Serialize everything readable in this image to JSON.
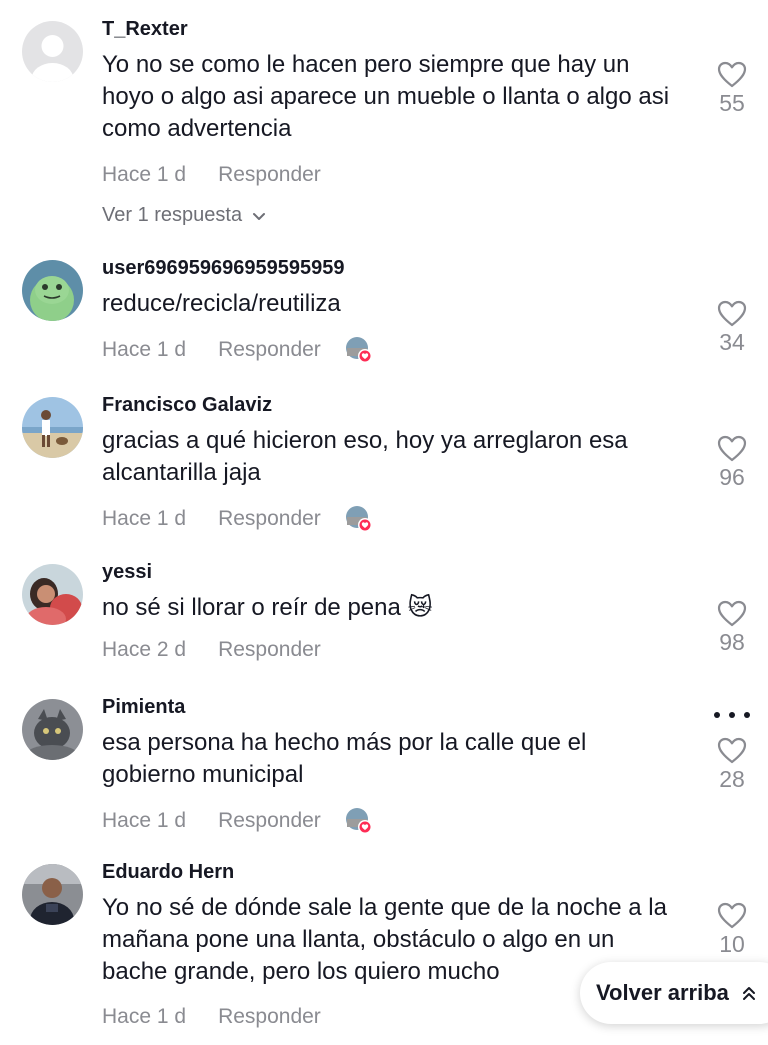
{
  "comments": [
    {
      "username": "T_Rexter",
      "text": "Yo no se como le hacen pero siempre que hay un hoyo o algo asi aparece un mueble o llanta o algo asi como advertencia",
      "time": "Hace 1 d",
      "reply_label": "Responder",
      "likes": "55",
      "view_replies": "Ver 1 respuesta",
      "avatar": "default-avatar"
    },
    {
      "username": "user696959696959595959",
      "text": "reduce/recicla/reutiliza",
      "time": "Hace 1 d",
      "reply_label": "Responder",
      "likes": "34",
      "creator_liked": true,
      "avatar": "green-frog-avatar"
    },
    {
      "username": "Francisco Galaviz",
      "text": "gracias a qué hicieron eso, hoy ya arreglaron esa alcantarilla jaja",
      "time": "Hace 1 d",
      "reply_label": "Responder",
      "likes": "96",
      "creator_liked": true,
      "avatar": "beach-photo-avatar"
    },
    {
      "username": "yessi",
      "text": "no sé si llorar o reír de pena 😿",
      "time": "Hace 2 d",
      "reply_label": "Responder",
      "likes": "98",
      "avatar": "selfie-avatar"
    },
    {
      "username": "Pimienta",
      "text": "esa persona ha hecho más por la calle que el gobierno municipal",
      "time": "Hace 1 d",
      "reply_label": "Responder",
      "likes": "28",
      "creator_liked": true,
      "avatar": "cat-avatar"
    },
    {
      "username": "Eduardo Hern",
      "text": "Yo no sé de dónde sale la gente que de la noche a la mañana pone una llanta, obstáculo o algo en un bache grande, pero los quiero mucho",
      "time": "Hace 1 d",
      "reply_label": "Responder",
      "likes": "10",
      "avatar": "man-photo-avatar"
    }
  ],
  "back_to_top": {
    "label": "Volver arriba",
    "icon": "double-chevron-up-icon"
  },
  "colors": {
    "text_primary": "#161823",
    "text_secondary": "#8a8b91",
    "creator_badge_red": "#fe2c55"
  }
}
